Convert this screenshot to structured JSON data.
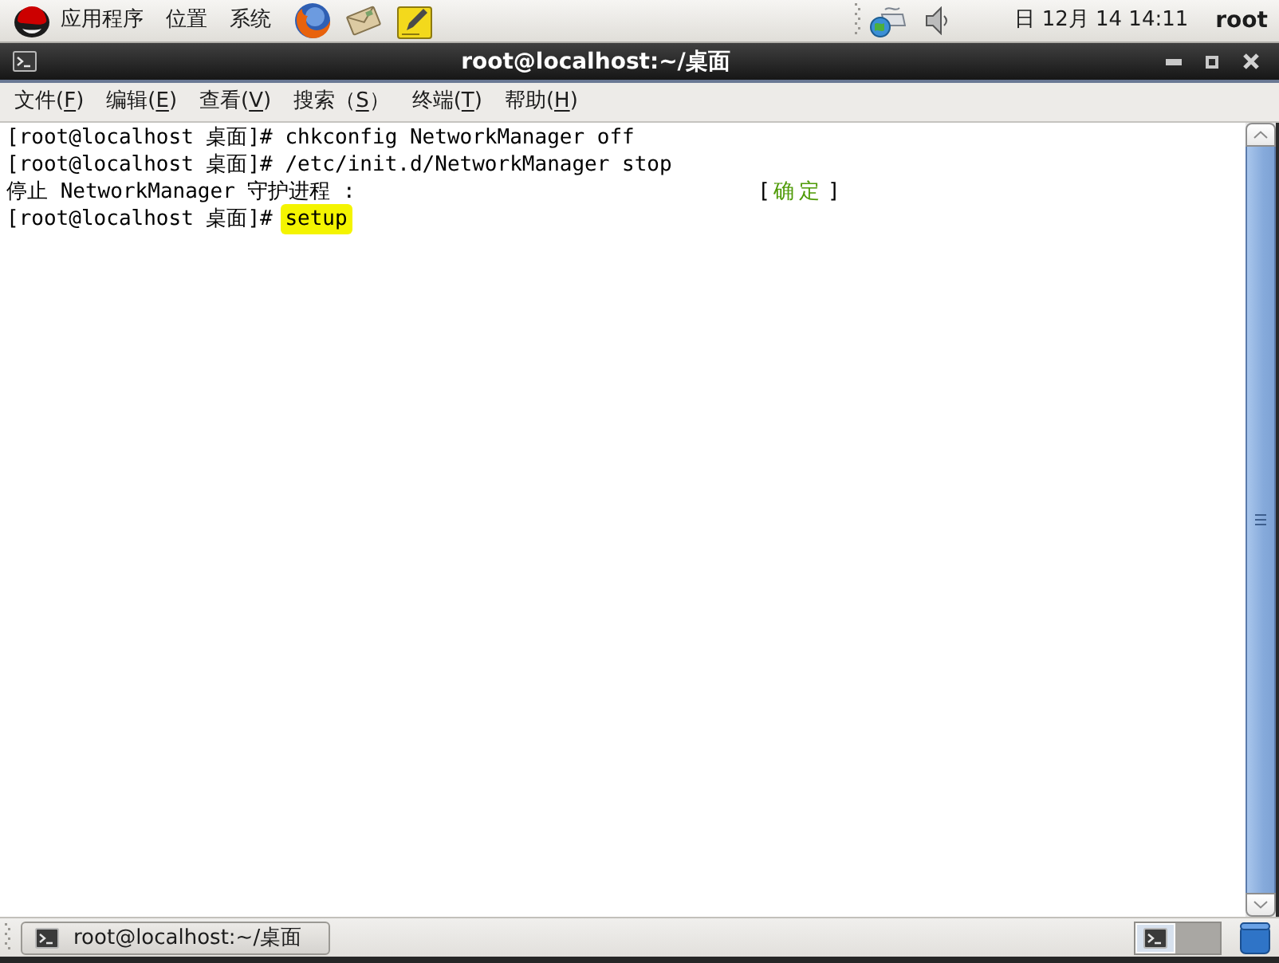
{
  "top_panel": {
    "menus": [
      "应用程序",
      "位置",
      "系统"
    ],
    "clock": "日 12月 14 14:11",
    "user": "root"
  },
  "window": {
    "title": "root@localhost:~/桌面"
  },
  "menu_bar": [
    {
      "before": "文件(",
      "key": "F",
      "after": ")"
    },
    {
      "before": "编辑(",
      "key": "E",
      "after": ")"
    },
    {
      "before": "查看(",
      "key": "V",
      "after": ")"
    },
    {
      "before": "搜索（",
      "key": "S",
      "after": "）"
    },
    {
      "before": "终端(",
      "key": "T",
      "after": ")"
    },
    {
      "before": "帮助(",
      "key": "H",
      "after": ")"
    }
  ],
  "terminal": {
    "lines": [
      {
        "kind": "command",
        "prompt": "[root@localhost 桌面]#",
        "command": "chkconfig NetworkManager off",
        "highlighted": false
      },
      {
        "kind": "command",
        "prompt": "[root@localhost 桌面]#",
        "command": "/etc/init.d/NetworkManager stop",
        "highlighted": false
      },
      {
        "kind": "status",
        "message": "停止 NetworkManager 守护进程 :",
        "open": "[",
        "status": "确定",
        "close": "]"
      },
      {
        "kind": "command",
        "prompt": "[root@localhost 桌面]#",
        "command": "setup",
        "highlighted": true
      }
    ]
  },
  "bottom_panel": {
    "task": "root@localhost:~/桌面",
    "workspaces": [
      {
        "selected": true
      },
      {
        "selected": false
      }
    ]
  }
}
